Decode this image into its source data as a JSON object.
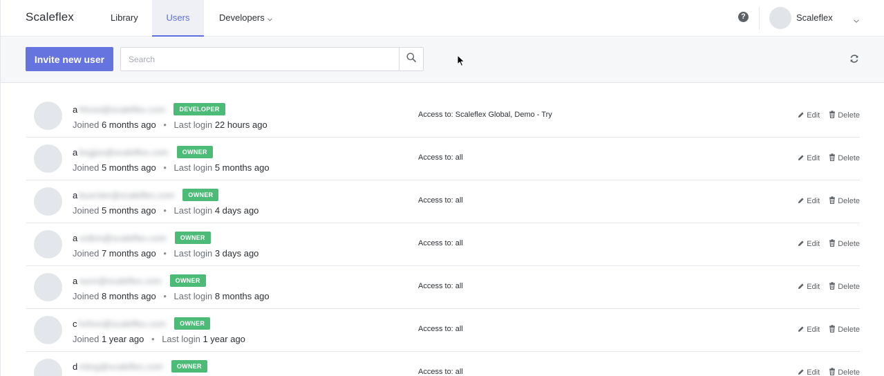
{
  "brand": "Scaleflex",
  "nav": {
    "library": "Library",
    "users": "Users",
    "developers": "Developers"
  },
  "account": {
    "name": "Scaleflex",
    "help_symbol": "?"
  },
  "toolbar": {
    "invite_label": "Invite new user",
    "search_placeholder": "Search"
  },
  "labels": {
    "joined": "Joined",
    "last_login": "Last login",
    "edit": "Edit",
    "delete": "Delete"
  },
  "users": [
    {
      "initial": "a",
      "email": "hfvssi@scaleflex.com",
      "role": "DEVELOPER",
      "joined": "6 months ago",
      "last_login": "22 hours ago",
      "access": "Access to: Scaleflex Global, Demo - Try"
    },
    {
      "initial": "a",
      "email": "bxgjso@scaleflex.com",
      "role": "OWNER",
      "joined": "5 months ago",
      "last_login": "5 months ago",
      "access": "Access to: all"
    },
    {
      "initial": "a",
      "email": "buxrsler@scaleflex.com",
      "role": "OWNER",
      "joined": "5 months ago",
      "last_login": "4 days ago",
      "access": "Access to: all"
    },
    {
      "initial": "a",
      "email": "votkm@scaleflex.com",
      "role": "OWNER",
      "joined": "7 months ago",
      "last_login": "3 days ago",
      "access": "Access to: all"
    },
    {
      "initial": "a",
      "email": "xunv@scaleflex.com",
      "role": "OWNER",
      "joined": "8 months ago",
      "last_login": "8 months ago",
      "access": "Access to: all"
    },
    {
      "initial": "c",
      "email": "hvhnx@scaleflex.com",
      "role": "OWNER",
      "joined": "1 year ago",
      "last_login": "1 year ago",
      "access": "Access to: all"
    },
    {
      "initial": "d",
      "email": "mbrg@scaleflex.com",
      "role": "OWNER",
      "joined": "",
      "last_login": "",
      "access": "Access to: all"
    }
  ],
  "colors": {
    "accent": "#6674e0",
    "badge": "#4cbb77",
    "active_tab_bg": "#eef0f5",
    "toolbar_bg": "#f6f7f9"
  },
  "icons": {
    "search": "search-icon",
    "refresh": "refresh-icon",
    "help": "help-icon",
    "edit": "pencil-icon",
    "delete": "trash-icon",
    "dropdown": "chevron-down-icon"
  }
}
